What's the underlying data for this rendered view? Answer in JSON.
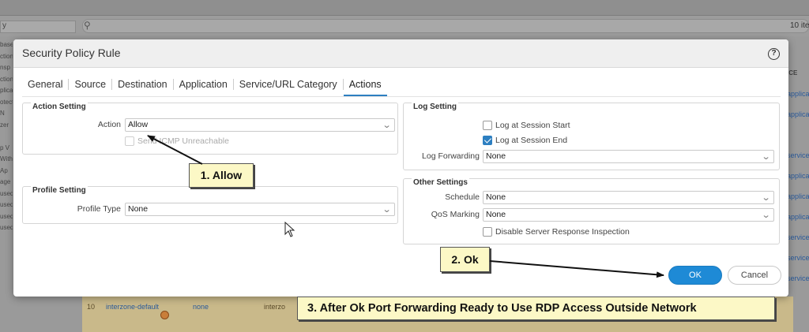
{
  "background": {
    "left_select": "y",
    "count_text": "10 ite",
    "left_col_text": [
      "base",
      "ction",
      "nsp",
      "ction",
      "plica",
      "otect",
      "N",
      "zer",
      "",
      "p V",
      "Withd",
      "Ap",
      "age",
      "used",
      "used",
      "used",
      "used"
    ],
    "right_col_header": "ICE",
    "right_col_items": [
      "applica",
      "applica",
      "",
      "service",
      "applica",
      "applica",
      "applica",
      "service",
      "service",
      "service"
    ],
    "bottom_row": {
      "num": "10",
      "name": "interzone-default",
      "tag": "none",
      "zone": "interzo"
    }
  },
  "dialog": {
    "title": "Security Policy Rule",
    "help_icon": "?",
    "tabs": [
      "General",
      "Source",
      "Destination",
      "Application",
      "Service/URL Category",
      "Actions"
    ],
    "active_tab": "Actions"
  },
  "action_setting": {
    "title": "Action Setting",
    "action_label": "Action",
    "action_value": "Allow",
    "send_icmp_label": "Send ICMP Unreachable",
    "send_icmp_checked": false
  },
  "profile_setting": {
    "title": "Profile Setting",
    "profile_type_label": "Profile Type",
    "profile_type_value": "None"
  },
  "log_setting": {
    "title": "Log Setting",
    "log_start_label": "Log at Session Start",
    "log_start_checked": false,
    "log_end_label": "Log at Session End",
    "log_end_checked": true,
    "log_forwarding_label": "Log Forwarding",
    "log_forwarding_value": "None"
  },
  "other_settings": {
    "title": "Other Settings",
    "schedule_label": "Schedule",
    "schedule_value": "None",
    "qos_label": "QoS Marking",
    "qos_value": "None",
    "disable_srv_label": "Disable Server Response Inspection",
    "disable_srv_checked": false
  },
  "buttons": {
    "ok": "OK",
    "cancel": "Cancel"
  },
  "annotations": {
    "step1": "1. Allow",
    "step2": "2. Ok",
    "step3": "3. After Ok Port Forwarding Ready to Use RDP Access Outside Network"
  },
  "colors": {
    "accent": "#2d7fc1",
    "ok_button": "#1e8ad6",
    "callout_bg": "#fcf8c6"
  }
}
